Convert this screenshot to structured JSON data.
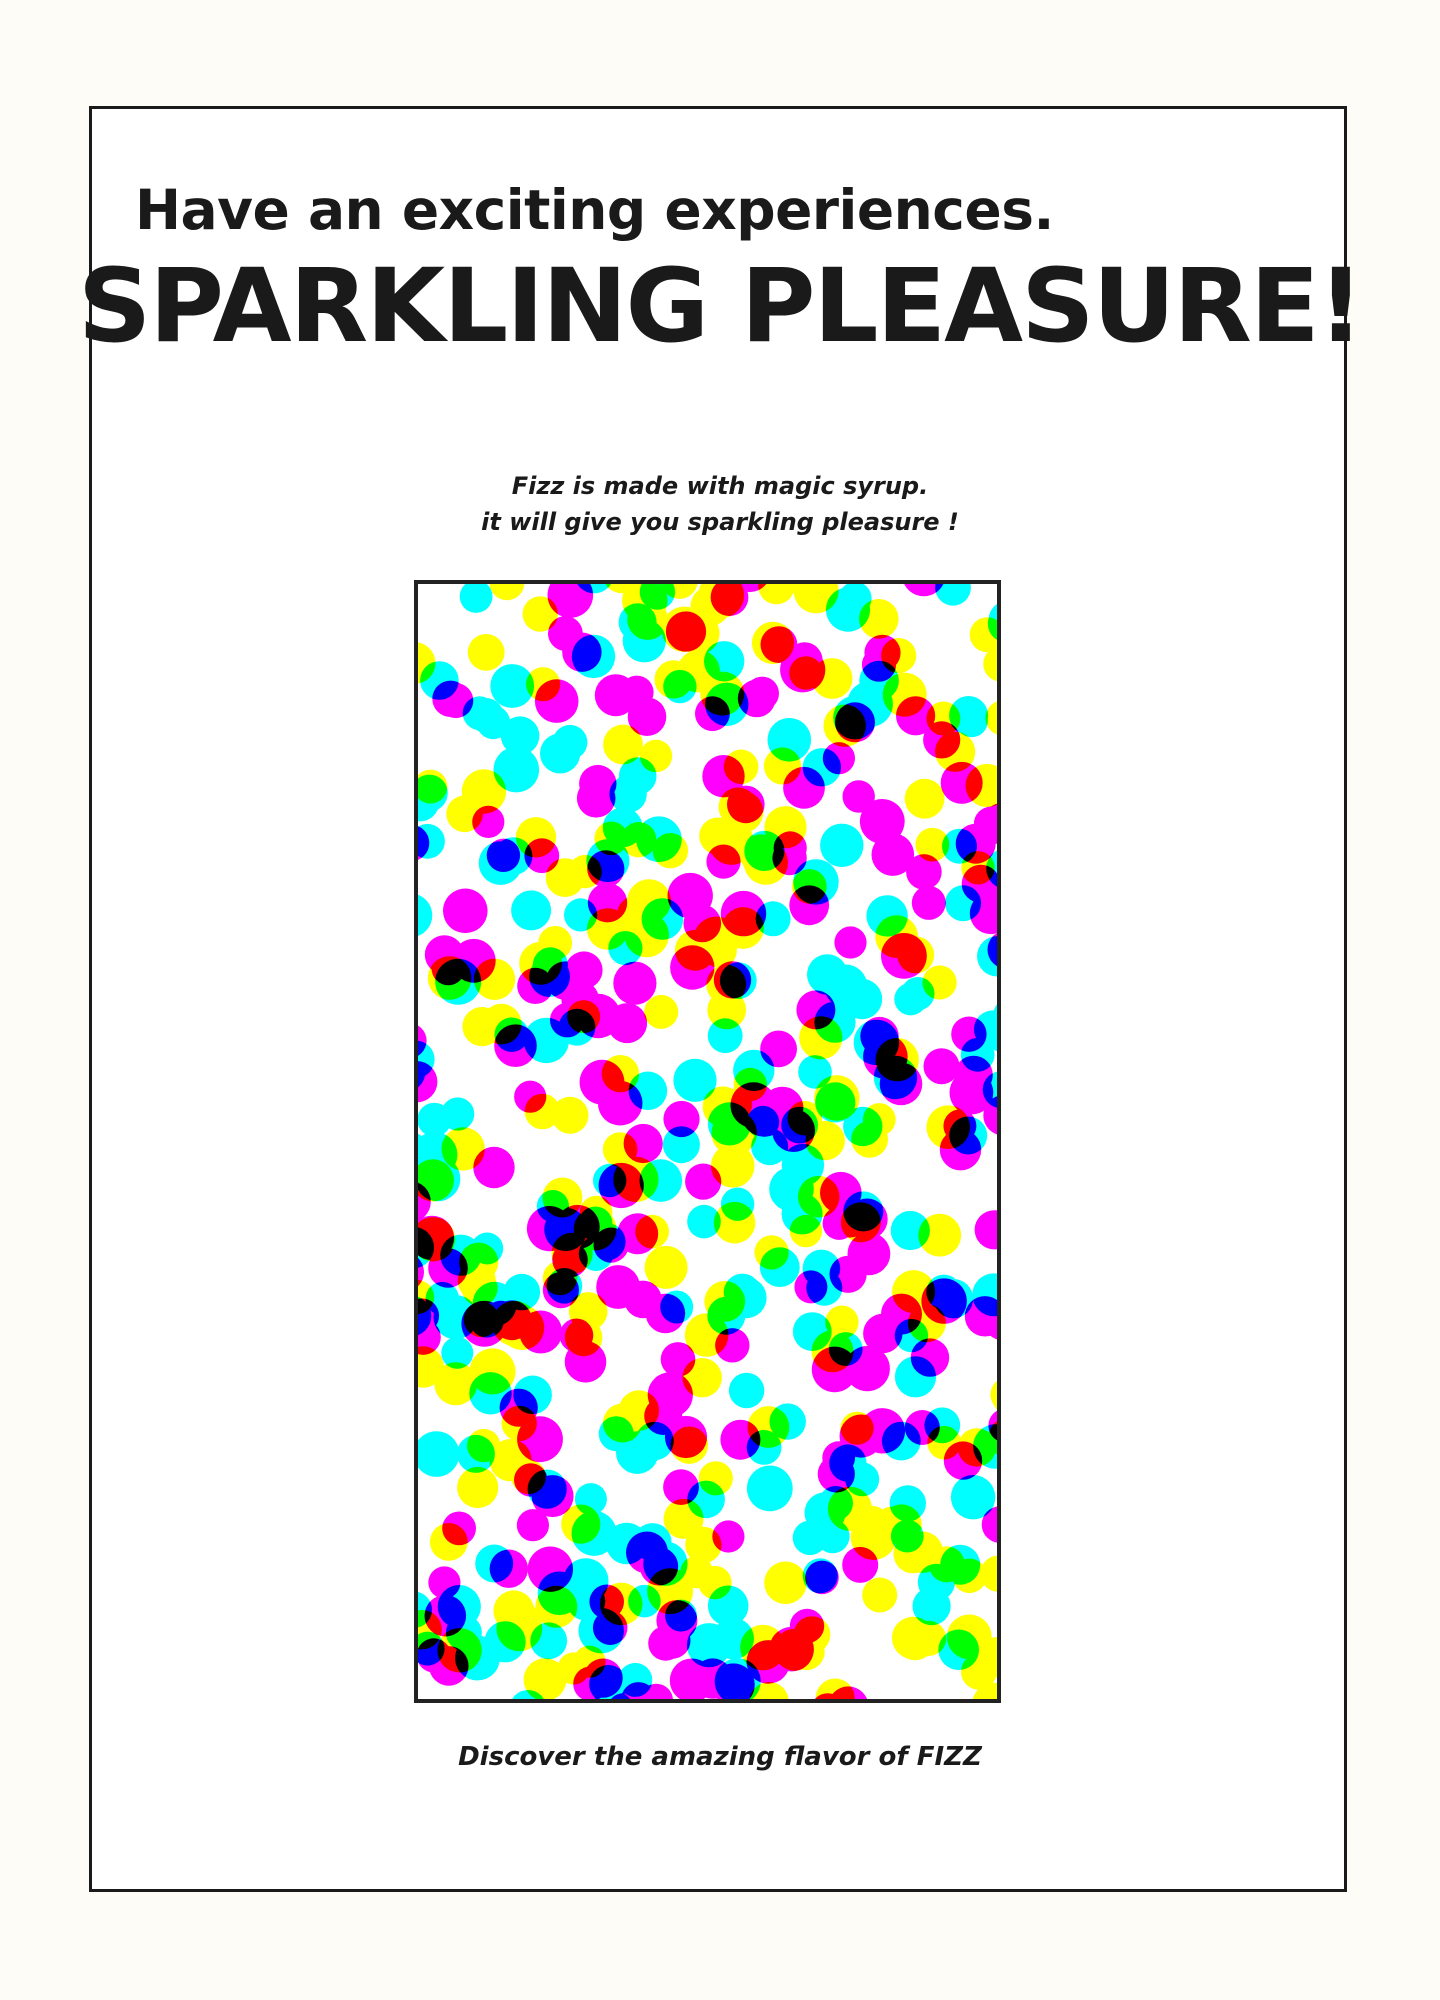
{
  "header": {
    "subtitle": "Have an exciting experiences.",
    "headline": "SPARKLING PLEASURE!"
  },
  "intro": {
    "line1": "Fizz is made with magic syrup.",
    "line2": "it will give you sparkling pleasure !"
  },
  "footer": {
    "text": "Discover the amazing flavor of FIZZ"
  },
  "colors": {
    "background": "#fdfcf6",
    "panel": "#ffffff",
    "ink": "#1a1a1a",
    "bubble_cyan": "#00ffff",
    "bubble_magenta": "#ff00ff",
    "bubble_yellow": "#ffff00"
  }
}
